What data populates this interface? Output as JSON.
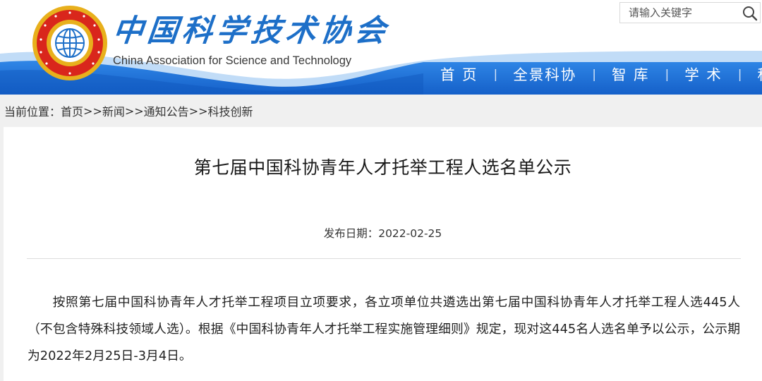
{
  "header": {
    "logo_name": "cast-emblem",
    "name_cn": "中国科学技术协会",
    "name_en": "China Association for Science and Technology",
    "colors": {
      "brand": "#1d6fc8",
      "nav_bar": "#1a6bd6",
      "logo_gold": "#e8b01c",
      "logo_red": "#d9261c"
    }
  },
  "search": {
    "placeholder": "请输入关键字",
    "icon": "search-icon"
  },
  "nav": {
    "items": [
      {
        "label": "首 页"
      },
      {
        "label": "全景科协"
      },
      {
        "label": "智 库"
      },
      {
        "label": "学 术"
      },
      {
        "label": "科"
      }
    ],
    "separator": "|"
  },
  "breadcrumb": {
    "prefix": "当前位置：",
    "items": [
      "首页",
      "新闻",
      "通知公告",
      "科技创新"
    ],
    "separator": ">>"
  },
  "article": {
    "title": "第七届中国科协青年人才托举工程人选名单公示",
    "publish_label": "发布日期：",
    "publish_date": "2022-02-25",
    "body": "按照第七届中国科协青年人才托举工程项目立项要求，各立项单位共遴选出第七届中国科协青年人才托举工程人选445人（不包含特殊科技领域人选）。根据《中国科协青年人才托举工程实施管理细则》规定，现对这445名人选名单予以公示，公示期为2022年2月25日-3月4日。"
  }
}
